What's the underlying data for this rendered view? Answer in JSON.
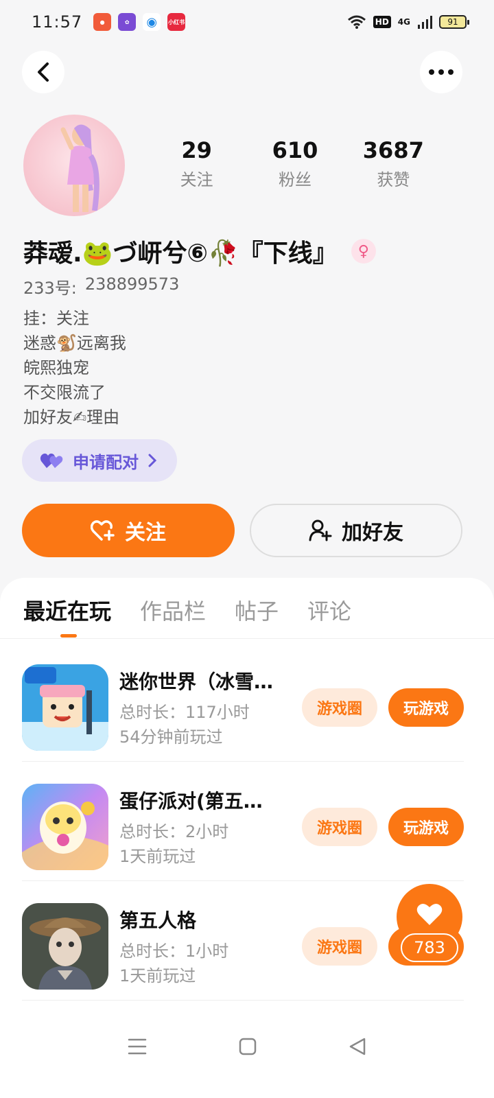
{
  "status_bar": {
    "time": "11:57",
    "network": "4G",
    "hd": "HD",
    "battery": "91",
    "apps": [
      {
        "icon": "app-icon-1",
        "color": "#f15b3a"
      },
      {
        "icon": "app-icon-2",
        "color": "#7a4bd4"
      },
      {
        "icon": "app-icon-3",
        "color": "#1e88e5"
      },
      {
        "icon": "app-icon-4",
        "color": "#e7293f",
        "text": "小红书"
      }
    ]
  },
  "profile": {
    "stats": [
      {
        "value": "29",
        "label": "关注"
      },
      {
        "value": "610",
        "label": "粉丝"
      },
      {
        "value": "3687",
        "label": "获赞"
      }
    ],
    "nickname": "莽叆.🐸づ岍兮⑥🥀『下线』",
    "uid_label": "233号:",
    "uid_value": "238899573",
    "bio_lines": [
      "挂：关注",
      "迷惑🐒远离我",
      "皖熙独宠",
      "不交限流了",
      "加好友✍理由"
    ],
    "pair_label": "申请配对"
  },
  "actions": {
    "follow": "关注",
    "add_friend": "加好友"
  },
  "tabs": [
    "最近在玩",
    "作品栏",
    "帖子",
    "评论"
  ],
  "games": [
    {
      "name": "迷你世界（冰雪…",
      "total": "总时长：117小时",
      "last": "54分钟前玩过",
      "icon": "mini-world-icon",
      "circle": "游戏圈",
      "play": "玩游戏"
    },
    {
      "name": "蛋仔派对(第五…",
      "total": "总时长：2小时",
      "last": "1天前玩过",
      "icon": "eggy-party-icon",
      "circle": "游戏圈",
      "play": "玩游戏"
    },
    {
      "name": "第五人格",
      "total": "总时长：1小时",
      "last": "1天前玩过",
      "icon": "identity-v-icon",
      "circle": "游戏圈",
      "play": ""
    }
  ],
  "like_count": "783",
  "colors": {
    "accent": "#fb7714",
    "pair": "#6757d8",
    "gender": "#f05a87"
  }
}
